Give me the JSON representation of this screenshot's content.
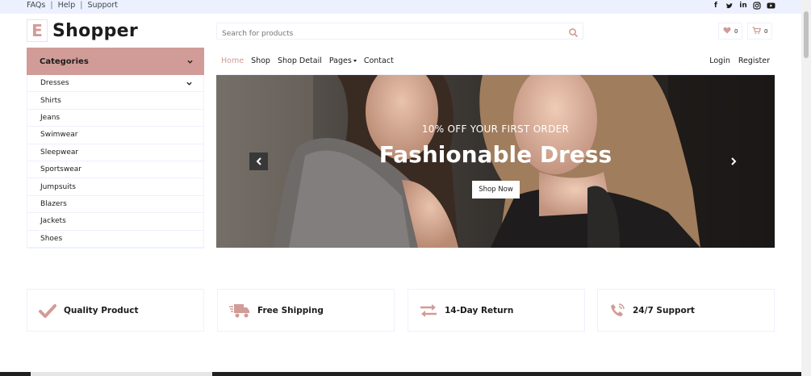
{
  "topbar": {
    "links": [
      "FAQs",
      "Help",
      "Support"
    ],
    "social_icons": [
      "facebook-icon",
      "twitter-icon",
      "linkedin-icon",
      "instagram-icon",
      "youtube-icon"
    ]
  },
  "brand": {
    "logo_letter": "E",
    "name": "Shopper"
  },
  "search": {
    "placeholder": "Search for products",
    "icon": "search-icon"
  },
  "header_buttons": {
    "wishlist": {
      "icon": "heart-icon",
      "count": "0"
    },
    "cart": {
      "icon": "cart-icon",
      "count": "0"
    }
  },
  "categories": {
    "title": "Categories",
    "items": [
      "Dresses",
      "Shirts",
      "Jeans",
      "Swimwear",
      "Sleepwear",
      "Sportswear",
      "Jumpsuits",
      "Blazers",
      "Jackets",
      "Shoes"
    ]
  },
  "nav": {
    "links": [
      "Home",
      "Shop",
      "Shop Detail",
      "Pages",
      "Contact"
    ],
    "active": "Home",
    "right": [
      "Login",
      "Register"
    ]
  },
  "hero": {
    "subtitle": "10% OFF YOUR FIRST ORDER",
    "title": "Fashionable Dress",
    "button": "Shop Now"
  },
  "features": [
    {
      "icon": "check-icon",
      "label": "Quality Product"
    },
    {
      "icon": "shipping-icon",
      "label": "Free Shipping"
    },
    {
      "icon": "exchange-icon",
      "label": "14-Day Return"
    },
    {
      "icon": "phone-icon",
      "label": "24/7 Support"
    }
  ],
  "colors": {
    "accent": "#d19c97",
    "topbar": "#edf1ff",
    "text": "#1c1c1c"
  }
}
